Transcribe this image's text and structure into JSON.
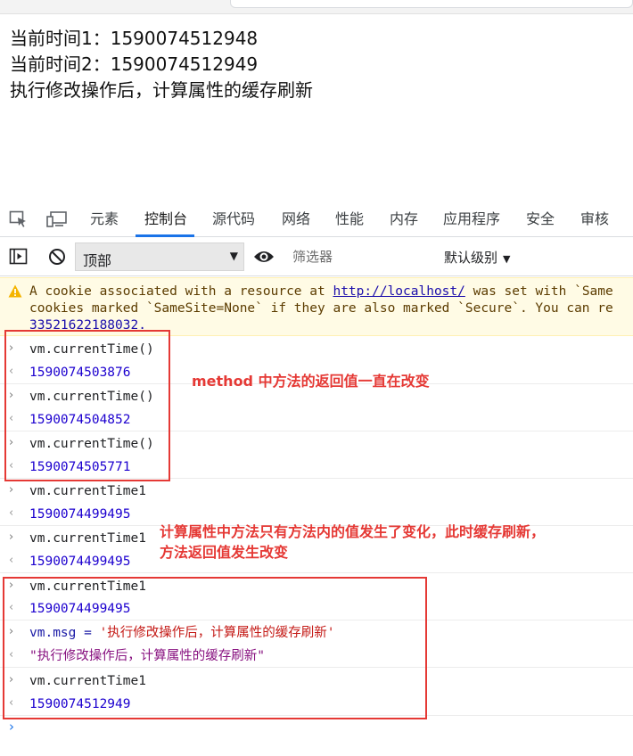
{
  "page": {
    "line1": "当前时间1：1590074512948",
    "line2": "当前时间2：1590074512949",
    "line3": "执行修改操作后，计算属性的缓存刷新"
  },
  "devtools": {
    "tabs": [
      "元素",
      "控制台",
      "源代码",
      "网络",
      "性能",
      "内存",
      "应用程序",
      "安全",
      "审核"
    ],
    "active_tab": "控制台",
    "accent": "#1a73e8"
  },
  "toolbar": {
    "context": "顶部",
    "filter_placeholder": "筛选器",
    "level": "默认级别"
  },
  "warning": {
    "line1_pre": "A cookie associated with a resource at ",
    "line1_link": "http://localhost/",
    "line1_post": " was set with `Same",
    "line2": "cookies marked `SameSite=None` if they are also marked `Secure`. You can re",
    "line3": "33521622188032."
  },
  "console": [
    {
      "kind": "in",
      "text": "vm.currentTime()"
    },
    {
      "kind": "out",
      "text": "1590074503876",
      "type": "num"
    },
    {
      "kind": "in",
      "text": "vm.currentTime()"
    },
    {
      "kind": "out",
      "text": "1590074504852",
      "type": "num"
    },
    {
      "kind": "in",
      "text": "vm.currentTime()"
    },
    {
      "kind": "out",
      "text": "1590074505771",
      "type": "num"
    },
    {
      "kind": "in",
      "text": "vm.currentTime1"
    },
    {
      "kind": "out",
      "text": "1590074499495",
      "type": "num"
    },
    {
      "kind": "in",
      "text": "vm.currentTime1"
    },
    {
      "kind": "out",
      "text": "1590074499495",
      "type": "num"
    },
    {
      "kind": "in",
      "text": "vm.currentTime1"
    },
    {
      "kind": "out",
      "text": "1590074499495",
      "type": "num"
    },
    {
      "kind": "in",
      "text_pre": "vm.msg = ",
      "text_str": "'执行修改操作后，计算属性的缓存刷新'"
    },
    {
      "kind": "out",
      "text": "\"执行修改操作后，计算属性的缓存刷新\"",
      "type": "str"
    },
    {
      "kind": "in",
      "text": "vm.currentTime1"
    },
    {
      "kind": "out",
      "text": "1590074512949",
      "type": "num"
    }
  ],
  "annotations": {
    "method_note": "method 中方法的返回值一直在改变",
    "computed_note_1": "计算属性中方法只有方法内的值发生了变化，此时缓存刷新，",
    "computed_note_2": "方法返回值发生改变",
    "color": "#e53935"
  }
}
